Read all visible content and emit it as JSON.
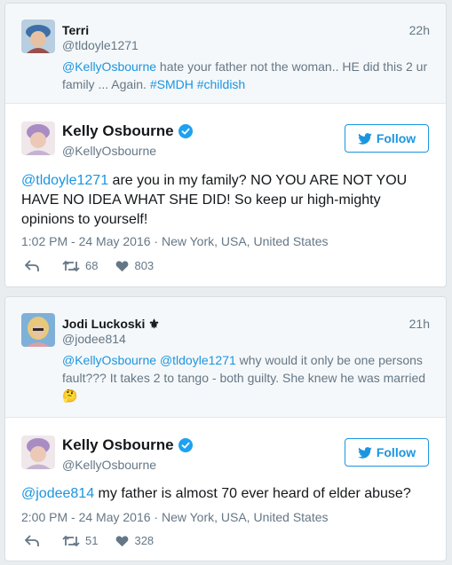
{
  "thread": [
    {
      "reply": {
        "name": "Terri",
        "handle": "@tldoyle1271",
        "time": "22h",
        "text_parts": [
          {
            "t": "@KellyOsbourne",
            "link": true
          },
          {
            "t": " hate your father not the woman.. HE did this 2 ur family ... Again. ",
            "link": false
          },
          {
            "t": "#SMDH",
            "link": true
          },
          {
            "t": " ",
            "link": false
          },
          {
            "t": "#childish",
            "link": true
          }
        ]
      },
      "main": {
        "name": "Kelly Osbourne",
        "handle": "@KellyOsbourne",
        "follow_label": "Follow",
        "text_parts": [
          {
            "t": "@tldoyle1271",
            "link": true
          },
          {
            "t": " are you in my family? NO YOU ARE NOT YOU HAVE NO IDEA WHAT SHE DID! So keep ur high-mighty opinions to yourself!",
            "link": false
          }
        ],
        "meta": "1:02 PM - 24 May 2016 · New York, USA, United States",
        "retweets": "68",
        "likes": "803"
      }
    },
    {
      "reply": {
        "name": "Jodi Luckoski",
        "name_suffix": "⚜",
        "handle": "@jodee814",
        "time": "21h",
        "text_parts": [
          {
            "t": "@KellyOsbourne",
            "link": true
          },
          {
            "t": " ",
            "link": false
          },
          {
            "t": "@tldoyle1271",
            "link": true
          },
          {
            "t": " why would it only be one persons fault??? It takes 2 to tango - both guilty. She knew he was married ",
            "link": false
          },
          {
            "t": "🤔",
            "link": false
          }
        ]
      },
      "main": {
        "name": "Kelly Osbourne",
        "handle": "@KellyOsbourne",
        "follow_label": "Follow",
        "text_parts": [
          {
            "t": "@jodee814",
            "link": true
          },
          {
            "t": " my father is almost 70 ever heard of elder abuse?",
            "link": false
          }
        ],
        "meta": "2:00 PM - 24 May 2016 · New York, USA, United States",
        "retweets": "51",
        "likes": "328"
      }
    }
  ],
  "icons": {
    "reply": "reply-icon",
    "retweet": "retweet-icon",
    "like": "heart-icon",
    "verified": "verified-badge-icon",
    "bird": "twitter-bird-icon"
  },
  "colors": {
    "link": "#1b95e0",
    "muted": "#657786",
    "text": "#14171a",
    "reply_bg": "#f5f8fa"
  }
}
